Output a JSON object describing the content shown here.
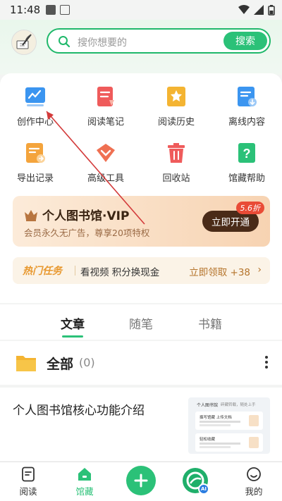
{
  "status": {
    "time": "11:48"
  },
  "search": {
    "placeholder": "搜你想要的",
    "button": "搜索"
  },
  "grid": [
    {
      "label": "创作中心",
      "icon": "chart-board-icon",
      "color": "#3b95f0"
    },
    {
      "label": "阅读笔记",
      "icon": "note-icon",
      "color": "#ef5b5b"
    },
    {
      "label": "阅读历史",
      "icon": "star-book-icon",
      "color": "#f4b432"
    },
    {
      "label": "离线内容",
      "icon": "download-doc-icon",
      "color": "#3b95f0"
    },
    {
      "label": "导出记录",
      "icon": "export-doc-icon",
      "color": "#f4a43c"
    },
    {
      "label": "高级工具",
      "icon": "heart-badge-icon",
      "color": "#ef7052"
    },
    {
      "label": "回收站",
      "icon": "trash-icon",
      "color": "#ef5b5b"
    },
    {
      "label": "馆藏帮助",
      "icon": "help-icon",
      "color": "#2bc178"
    }
  ],
  "vip": {
    "title": "个人图书馆·VIP",
    "subtitle": "会员永久无广告，尊享20项特权",
    "button": "立即开通",
    "discount": "5.6折"
  },
  "task": {
    "tag": "热门任务",
    "desc": "看视频 积分换现金",
    "action": "立即领取 +38",
    "arrow": "›"
  },
  "tabs": [
    "文章",
    "随笔",
    "书籍"
  ],
  "folder": {
    "name": "全部",
    "count": "(0)"
  },
  "article": {
    "title": "个人图书馆核心功能介绍",
    "thumb_title": "个人图书馆",
    "thumb_sub": "碎藏转载，随处上手",
    "thumb_card1": "撰写馆藏 上传文档",
    "thumb_card2": "轻松收藏"
  },
  "nav": [
    {
      "label": "阅读",
      "icon": "read-icon"
    },
    {
      "label": "馆藏",
      "icon": "library-icon"
    },
    {
      "label": "",
      "icon": "add-icon"
    },
    {
      "label": "",
      "icon": "ai-icon",
      "badge": "AI"
    },
    {
      "label": "我的",
      "icon": "profile-icon"
    }
  ],
  "colors": {
    "accent": "#2bc178",
    "vip_dark": "#4a2b18",
    "annotation": "#d33a3a"
  }
}
